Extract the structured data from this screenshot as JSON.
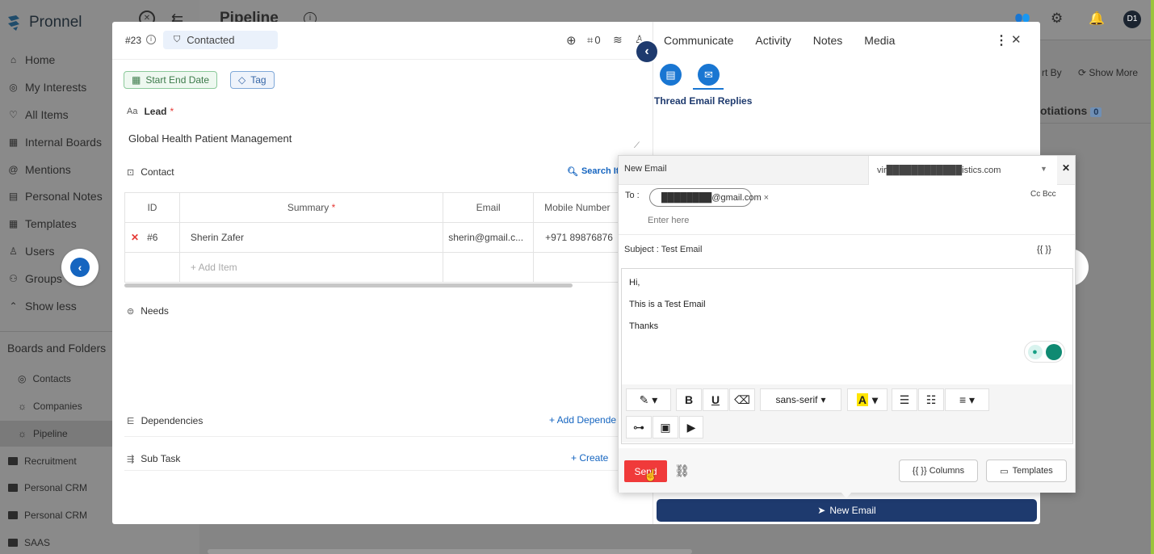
{
  "app": {
    "brand": "Pronnel",
    "page_title": "Pipeline",
    "avatar": "D1"
  },
  "sidebar": {
    "items": [
      {
        "label": "Home",
        "icon": "home-icon"
      },
      {
        "label": "My Interests",
        "icon": "interests-icon"
      },
      {
        "label": "All Items",
        "icon": "items-icon"
      },
      {
        "label": "Internal Boards",
        "icon": "boards-icon"
      },
      {
        "label": "Mentions",
        "icon": "at-icon"
      },
      {
        "label": "Personal Notes",
        "icon": "notes-icon"
      },
      {
        "label": "Templates",
        "icon": "templates-icon"
      },
      {
        "label": "Users",
        "icon": "user-icon"
      },
      {
        "label": "Groups",
        "icon": "group-icon"
      },
      {
        "label": "Show less",
        "icon": "chevron-up-icon"
      }
    ],
    "section_title": "Boards and Folders",
    "boards": [
      "Contacts",
      "Companies",
      "Pipeline"
    ],
    "folders": [
      "Recruitment",
      "Personal CRM",
      "Personal CRM",
      "SAAS"
    ]
  },
  "background": {
    "sort_by": "rt By",
    "show_more": "Show More",
    "quotations": "otiations",
    "quotations_count": "0"
  },
  "item": {
    "id": "#23",
    "status": "Contacted",
    "count": "0",
    "chips": {
      "date": "Start End Date",
      "tag": "Tag"
    },
    "lead_label": "Lead",
    "required_mark": "*",
    "lead_value": "Global Health Patient Management",
    "contact_label": "Contact",
    "search_items": "Search Ite",
    "table": {
      "headers": [
        "ID",
        "Summary",
        "Email",
        "Mobile Number"
      ],
      "rows": [
        {
          "id": "#6",
          "summary": "Sherin Zafer",
          "email": "sherin@gmail.c...",
          "mobile": "+971 89876876"
        }
      ],
      "add_item": "+ Add Item"
    },
    "needs_label": "Needs",
    "dependencies_label": "Dependencies",
    "add_dependency": "+ Add Depende",
    "subtask_label": "Sub Task",
    "create_label": "+ Create"
  },
  "right_panel": {
    "tabs": [
      "Communicate",
      "Activity",
      "Notes",
      "Media"
    ],
    "thread_title": "Thread Email Replies",
    "new_email_button": "New Email"
  },
  "email": {
    "title": "New Email",
    "from": "vir████████████istics.com",
    "to_label": "To :",
    "to_chip": "████████@gmail.com",
    "cc_bcc": "Cc Bcc",
    "enter_here": "Enter here",
    "subject": "Subject : Test Email",
    "placeholder_token": "{{ }}",
    "body_lines": [
      "Hi,",
      "This is a Test Email",
      "Thanks"
    ],
    "font": "sans-serif",
    "send": "Send",
    "columns": "{{ }} Columns",
    "templates": "Templates"
  },
  "colors": {
    "accent_blue": "#1565c0",
    "navy": "#1e3a6e",
    "send_red": "#f03a3a",
    "green": "#16a085"
  }
}
